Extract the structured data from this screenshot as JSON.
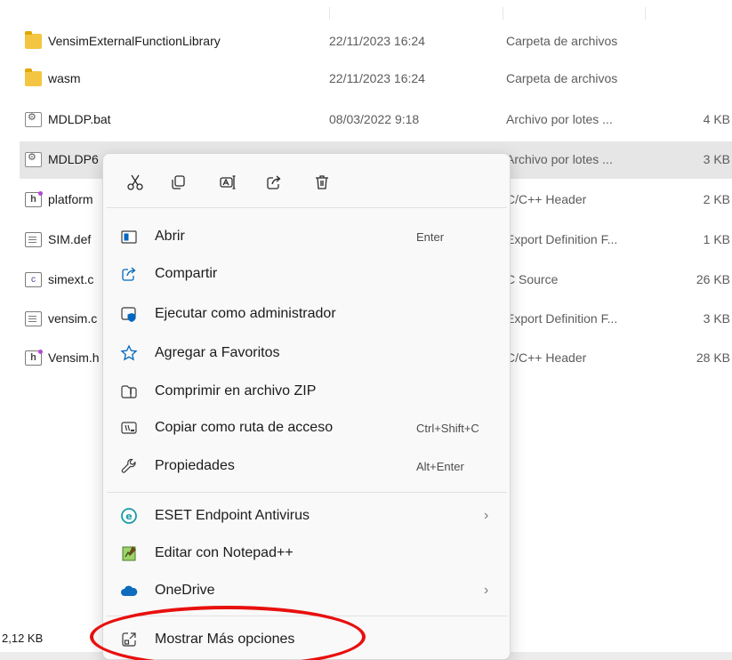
{
  "file_list": {
    "rows": [
      {
        "name": "VensimExternalFunctionLibrary",
        "date": "22/11/2023 16:24",
        "type": "Carpeta de archivos",
        "size": "",
        "icon": "folder-icon"
      },
      {
        "name": "wasm",
        "date": "22/11/2023 16:24",
        "type": "Carpeta de archivos",
        "size": "",
        "icon": "folder-icon"
      },
      {
        "name": "MDLDP.bat",
        "date": "08/03/2022 9:18",
        "type": "Archivo por lotes ...",
        "size": "4 KB",
        "icon": "batch-file-icon"
      },
      {
        "name": "MDLDP6",
        "date": "",
        "type": "Archivo por lotes ...",
        "size": "3 KB",
        "icon": "batch-file-icon"
      },
      {
        "name": "platform",
        "date": "",
        "type": "C/C++ Header",
        "size": "2 KB",
        "icon": "header-file-icon"
      },
      {
        "name": "SIM.def",
        "date": "",
        "type": "Export Definition F...",
        "size": "1 KB",
        "icon": "document-icon"
      },
      {
        "name": "simext.c",
        "date": "",
        "type": "C Source",
        "size": "26 KB",
        "icon": "c-source-icon"
      },
      {
        "name": "vensim.c",
        "date": "",
        "type": "Export Definition F...",
        "size": "3 KB",
        "icon": "document-icon"
      },
      {
        "name": "Vensim.h",
        "date": "",
        "type": "C/C++ Header",
        "size": "28 KB",
        "icon": "header-file-icon"
      }
    ]
  },
  "status_bar": {
    "text": "2,12 KB"
  },
  "context_menu": {
    "toolbar": [
      {
        "name": "cut",
        "icon": "scissors-icon"
      },
      {
        "name": "copy",
        "icon": "copy-icon"
      },
      {
        "name": "rename",
        "icon": "rename-icon"
      },
      {
        "name": "share",
        "icon": "share-icon"
      },
      {
        "name": "delete",
        "icon": "trash-icon"
      }
    ],
    "items": [
      {
        "label": "Abrir",
        "shortcut": "Enter",
        "icon": "open-window-icon"
      },
      {
        "label": "Compartir",
        "shortcut": "",
        "icon": "share-icon"
      },
      {
        "label": "Ejecutar como administrador",
        "shortcut": "",
        "icon": "admin-shield-icon"
      },
      {
        "label": "Agregar a Favoritos",
        "shortcut": "",
        "icon": "star-icon"
      },
      {
        "label": "Comprimir en archivo ZIP",
        "shortcut": "",
        "icon": "zip-folder-icon"
      },
      {
        "label": "Copiar como ruta de acceso",
        "shortcut": "Ctrl+Shift+C",
        "icon": "path-icon"
      },
      {
        "label": "Propiedades",
        "shortcut": "Alt+Enter",
        "icon": "wrench-icon"
      },
      {
        "label": "ESET Endpoint Antivirus",
        "shortcut": "",
        "icon": "eset-icon",
        "submenu": true
      },
      {
        "label": "Editar con Notepad++",
        "shortcut": "",
        "icon": "notepad-plus-icon"
      },
      {
        "label": "OneDrive",
        "shortcut": "",
        "icon": "cloud-icon",
        "submenu": true
      },
      {
        "label": "Mostrar Más opciones",
        "shortcut": "",
        "icon": "more-options-icon"
      }
    ]
  },
  "colors": {
    "selection": "#e6e6e6",
    "menu_bg": "#f9f9f9",
    "accent": "#0067c0",
    "annotation_red": "#e8100e"
  }
}
